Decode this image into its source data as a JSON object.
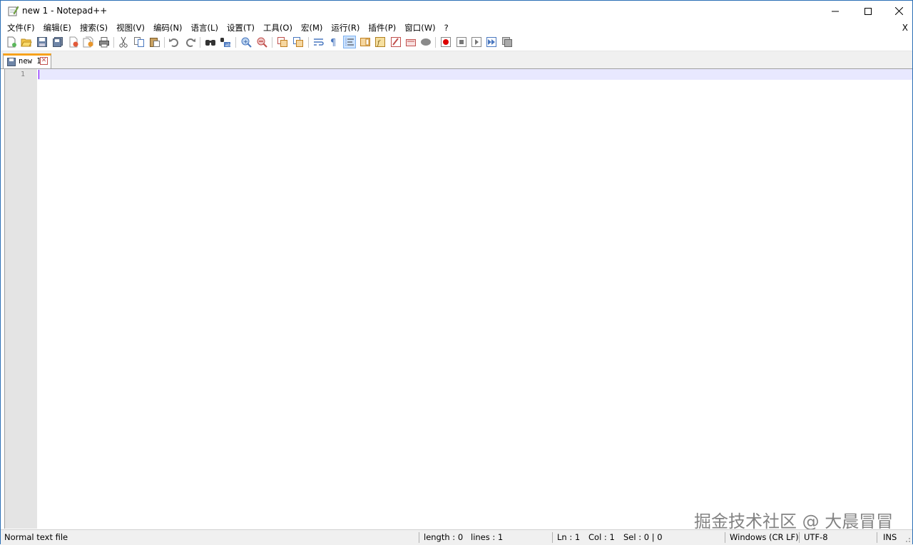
{
  "window": {
    "title": "new 1 - Notepad++"
  },
  "menu": {
    "items": [
      "文件(F)",
      "编辑(E)",
      "搜索(S)",
      "视图(V)",
      "编码(N)",
      "语言(L)",
      "设置(T)",
      "工具(O)",
      "宏(M)",
      "运行(R)",
      "插件(P)",
      "窗口(W)",
      "?"
    ],
    "close_label": "X"
  },
  "toolbar": {
    "icons": [
      "new-file-icon",
      "open-file-icon",
      "save-icon",
      "save-all-icon",
      "close-icon",
      "close-all-icon",
      "print-icon",
      "cut-icon",
      "copy-icon",
      "paste-icon",
      "undo-icon",
      "redo-icon",
      "find-icon",
      "replace-icon",
      "zoom-in-icon",
      "zoom-out-icon",
      "sync-vertical-icon",
      "sync-horizontal-icon",
      "word-wrap-icon",
      "show-all-chars-icon",
      "indent-guide-icon",
      "document-map-icon",
      "function-list-icon",
      "folder-as-workspace-icon",
      "monitoring-icon",
      "bubble-icon",
      "record-macro-icon",
      "stop-record-icon",
      "playback-macro-icon",
      "run-macro-multiple-icon",
      "save-macro-icon"
    ]
  },
  "tabs": [
    {
      "label": "new 1",
      "active": true
    }
  ],
  "editor": {
    "line_numbers": [
      "1"
    ],
    "content": ""
  },
  "watermark": "掘金技术社区 @ 大晨冒冒",
  "status": {
    "file_type": "Normal text file",
    "length": "length : 0",
    "lines": "lines : 1",
    "ln": "Ln : 1",
    "col": "Col : 1",
    "sel": "Sel : 0 | 0",
    "eol": "Windows (CR LF)",
    "encoding": "UTF-8",
    "mode": "INS"
  },
  "colors": {
    "tab_accent": "#f7a21b",
    "current_line": "#e8e8ff",
    "caret": "#8000ff",
    "gutter": "#e4e4e4"
  }
}
